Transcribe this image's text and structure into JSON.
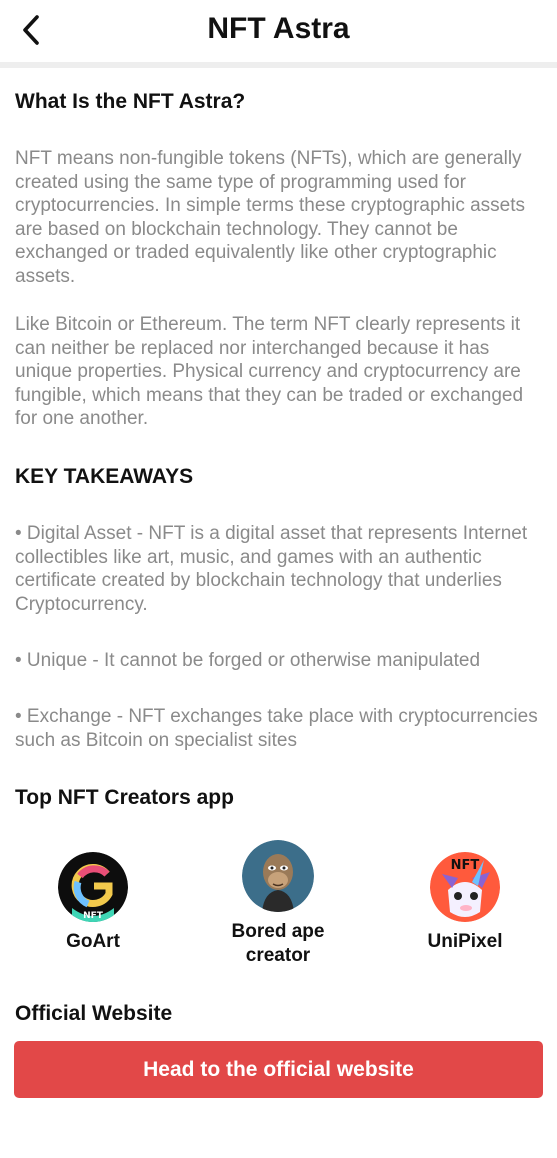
{
  "header": {
    "title": "NFT Astra",
    "back_icon": "chevron-left-icon"
  },
  "section_what": {
    "heading": "What Is the NFT Astra?",
    "paragraphs": [
      "NFT means non-fungible tokens (NFTs), which are generally created using the same type of programming used for cryptocurrencies. In simple terms these cryptographic assets are based on blockchain technology. They cannot be exchanged or traded equivalently like other cryptographic assets.",
      "Like Bitcoin or Ethereum. The term NFT clearly represents it can neither be replaced nor interchanged because it has unique properties. Physical currency and cryptocurrency are fungible, which means that they can be traded or exchanged for one another."
    ]
  },
  "section_takeaways": {
    "heading": "KEY TAKEAWAYS",
    "items": [
      "• Digital Asset - NFT is a digital asset that represents Internet collectibles like art, music, and games with an authentic certificate created by blockchain technology that underlies Cryptocurrency.",
      "• Unique - It cannot be forged or otherwise manipulated",
      "• Exchange - NFT exchanges take place with cryptocurrencies such as Bitcoin on specialist sites"
    ]
  },
  "section_creators": {
    "heading": "Top NFT Creators app",
    "items": [
      {
        "name": "GoArt",
        "logo_text": "NFT",
        "icon": "goart-logo-icon"
      },
      {
        "name": "Bored ape creator",
        "icon": "bored-ape-logo-icon"
      },
      {
        "name": "UniPixel",
        "logo_text": "NFT",
        "icon": "unipixel-logo-icon"
      }
    ]
  },
  "section_official": {
    "heading": "Official Website",
    "button_label": "Head to the official website"
  },
  "colors": {
    "accent": "#e24848",
    "body_text": "#8a8a8a",
    "heading_text": "#111111",
    "divider": "#eeeeee"
  }
}
